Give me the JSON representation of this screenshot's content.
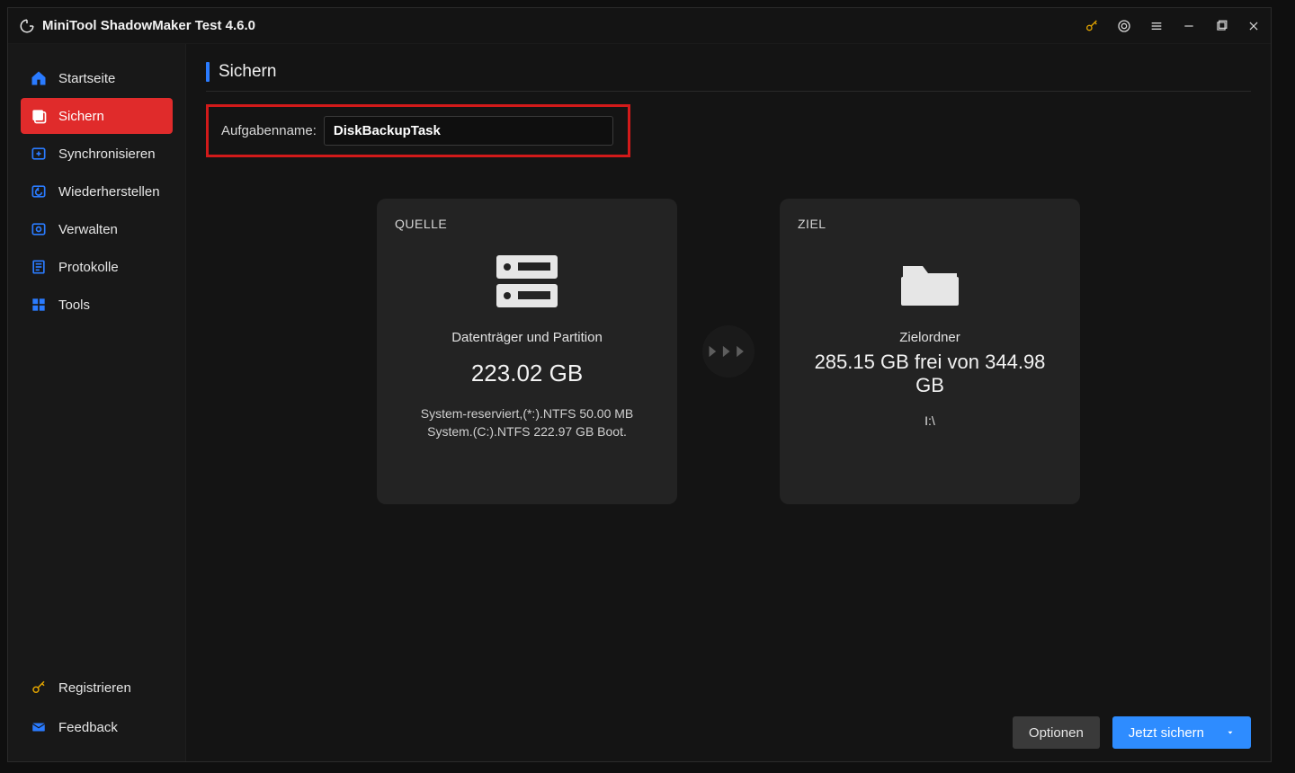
{
  "window": {
    "title": "MiniTool ShadowMaker Test 4.6.0"
  },
  "sidebar": {
    "items": [
      {
        "label": "Startseite"
      },
      {
        "label": "Sichern"
      },
      {
        "label": "Synchronisieren"
      },
      {
        "label": "Wiederherstellen"
      },
      {
        "label": "Verwalten"
      },
      {
        "label": "Protokolle"
      },
      {
        "label": "Tools"
      }
    ],
    "bottom": {
      "register": "Registrieren",
      "feedback": "Feedback"
    }
  },
  "page": {
    "title": "Sichern",
    "task_label": "Aufgabenname:",
    "task_value": "DiskBackupTask"
  },
  "source_panel": {
    "heading": "QUELLE",
    "subtitle": "Datenträger und Partition",
    "size": "223.02 GB",
    "detail": "System-reserviert,(*:).NTFS 50.00 MB System.(C:).NTFS 222.97 GB Boot."
  },
  "dest_panel": {
    "heading": "ZIEL",
    "subtitle": "Zielordner",
    "free": "285.15 GB frei von 344.98 GB",
    "path": "I:\\"
  },
  "footer": {
    "options": "Optionen",
    "backup_now": "Jetzt sichern"
  }
}
